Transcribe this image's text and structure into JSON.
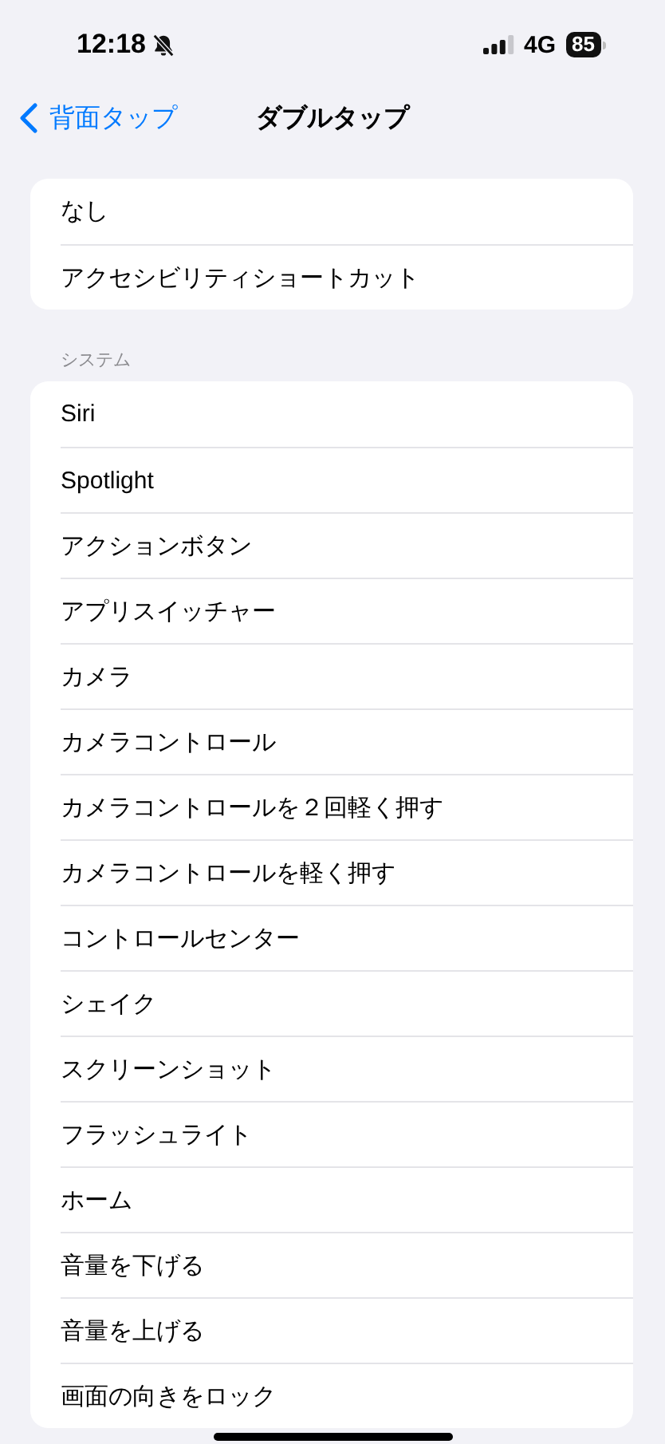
{
  "status_bar": {
    "time": "12:18",
    "network": "4G",
    "battery": "85"
  },
  "nav": {
    "back": "背面タップ",
    "title": "ダブルタップ"
  },
  "sections": [
    {
      "items": [
        {
          "label": "なし"
        },
        {
          "label": "アクセシビリティショートカット"
        }
      ]
    },
    {
      "header": "システム",
      "items": [
        {
          "label": "Siri"
        },
        {
          "label": "Spotlight"
        },
        {
          "label": "アクションボタン"
        },
        {
          "label": "アプリスイッチャー"
        },
        {
          "label": "カメラ"
        },
        {
          "label": "カメラコントロール"
        },
        {
          "label": "カメラコントロールを２回軽く押す"
        },
        {
          "label": "カメラコントロールを軽く押す"
        },
        {
          "label": "コントロールセンター"
        },
        {
          "label": "シェイク"
        },
        {
          "label": "スクリーンショット"
        },
        {
          "label": "フラッシュライト"
        },
        {
          "label": "ホーム"
        },
        {
          "label": "音量を下げる"
        },
        {
          "label": "音量を上げる"
        },
        {
          "label": "画面の向きをロック"
        }
      ]
    }
  ]
}
